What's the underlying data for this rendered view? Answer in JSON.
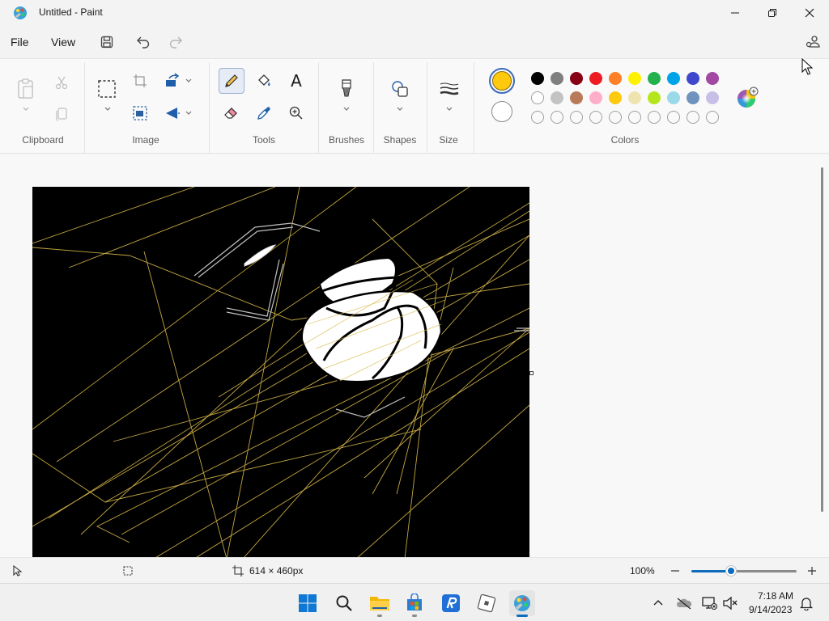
{
  "window": {
    "title": "Untitled - Paint"
  },
  "menu": {
    "file": "File",
    "view": "View"
  },
  "ribbon": {
    "groups": {
      "clipboard": "Clipboard",
      "image": "Image",
      "tools": "Tools",
      "brushes": "Brushes",
      "shapes": "Shapes",
      "size": "Size",
      "colors": "Colors"
    },
    "text_tool_glyph": "A"
  },
  "colors": {
    "primary": "#ffc90e",
    "secondary": "#ffffff",
    "palette_row1": [
      "#000000",
      "#7f7f7f",
      "#880015",
      "#ed1c24",
      "#ff7f27",
      "#fff200",
      "#22b14c",
      "#00a2e8",
      "#3f48cc",
      "#a349a4"
    ],
    "palette_row2": [
      "#ffffff",
      "#c3c3c3",
      "#b97a57",
      "#ffaec9",
      "#ffc90e",
      "#efe4b0",
      "#b5e61d",
      "#99d9ea",
      "#7092be",
      "#c8bfe7"
    ],
    "palette_row3_empty_count": 10,
    "accent": "#0f6cbd"
  },
  "status": {
    "canvas_size": "614 × 460px",
    "zoom": "100%",
    "zoom_level_fraction": 0.38
  },
  "taskbar": {
    "time": "7:18 AM",
    "date": "9/14/2023",
    "icons": [
      "windows-start-icon",
      "search-icon",
      "file-explorer-icon",
      "microsoft-store-icon",
      "roblox-studio-icon",
      "roblox-icon",
      "paint-icon"
    ]
  }
}
